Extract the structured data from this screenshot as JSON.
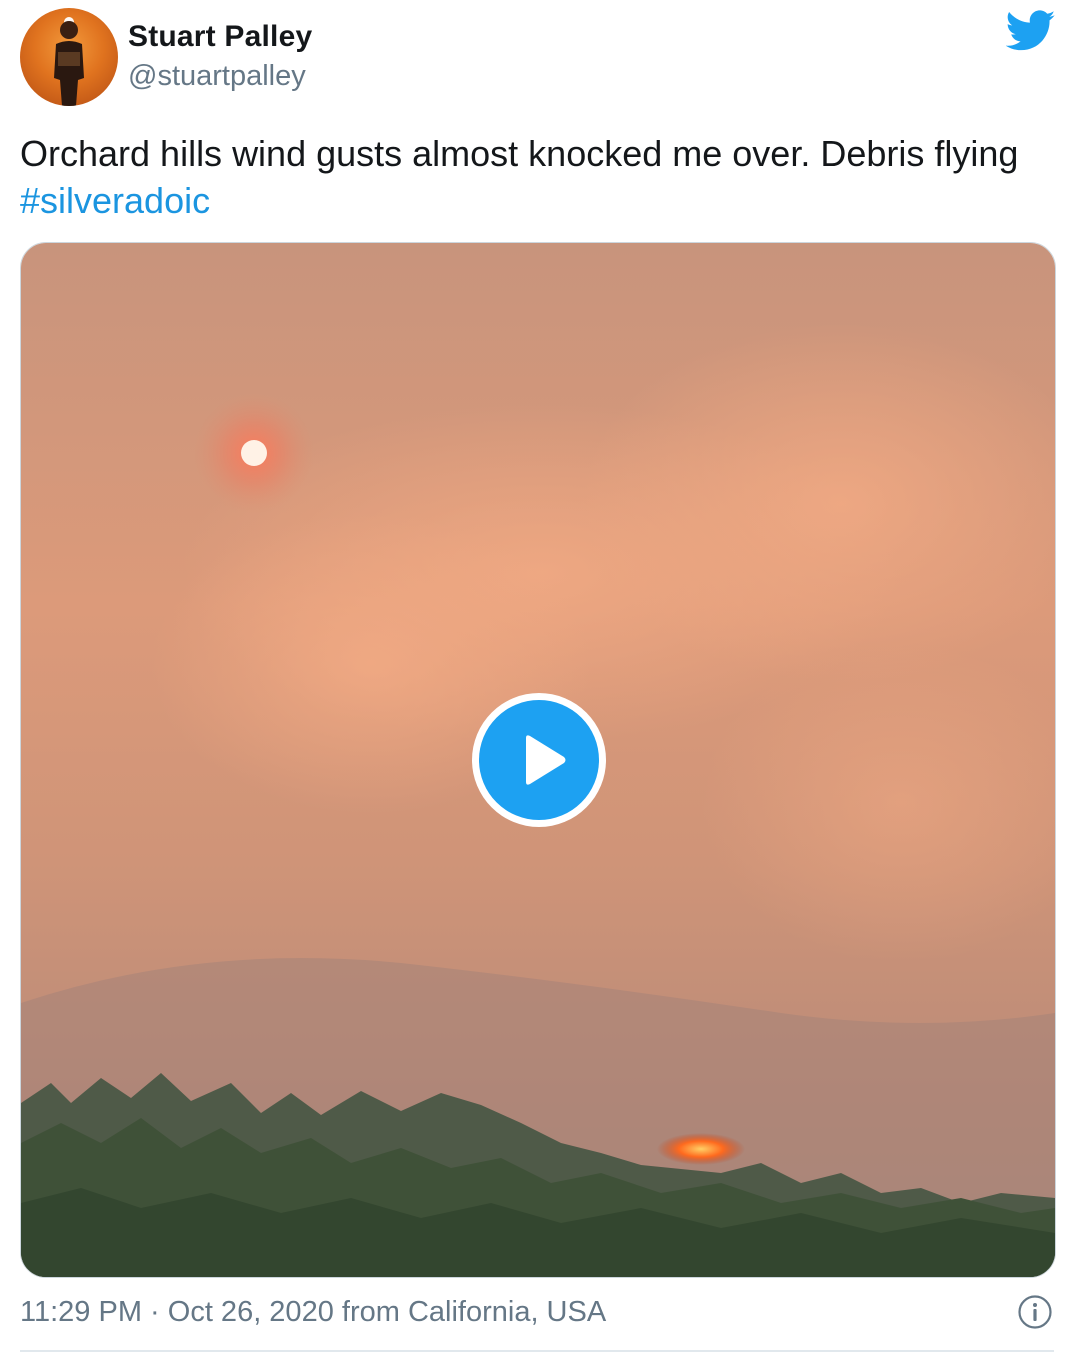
{
  "author": {
    "name": "Stuart Palley",
    "handle": "@stuartpalley"
  },
  "tweet": {
    "text": "Orchard hills wind gusts almost knocked me over. Debris flying ",
    "hashtag": "#silveradoic"
  },
  "meta": {
    "time": "11:29 PM",
    "separator": " · ",
    "date": "Oct 26, 2020",
    "location": " from California, USA"
  },
  "icons": {
    "brand": "twitter-bird-icon",
    "play": "play-icon",
    "info": "info-icon"
  },
  "colors": {
    "brand": "#1da1f2",
    "hashtag": "#1b95e0",
    "secondary_text": "#657786",
    "primary_text": "#14171a"
  }
}
